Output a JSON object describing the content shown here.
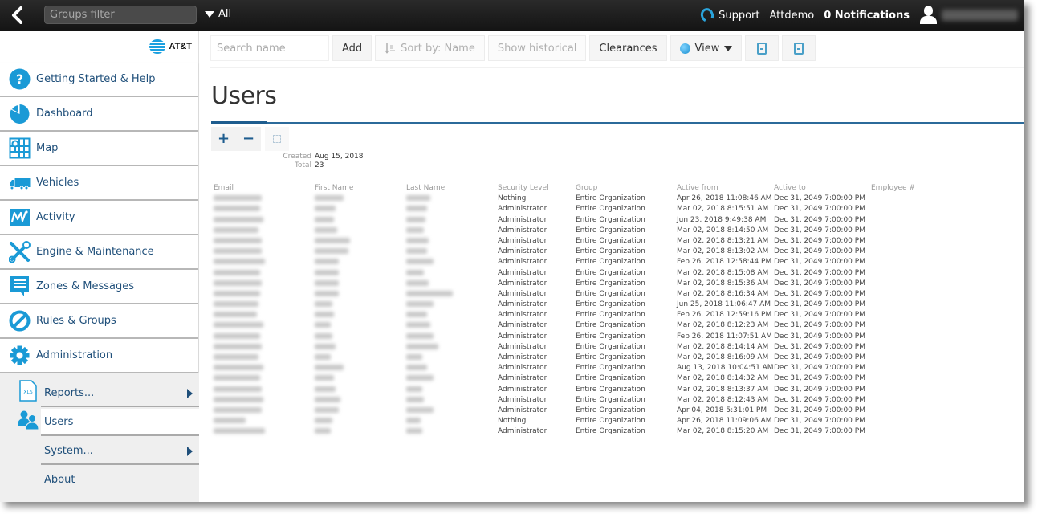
{
  "topbar": {
    "groups_filter_placeholder": "Groups filter",
    "groups_filter_value": "",
    "group_dropdown": "All",
    "support": "Support",
    "account": "Attdemo",
    "notifications": "0 Notifications"
  },
  "brand": {
    "name": "AT&T",
    "color": "#1aa0e0"
  },
  "sidebar": {
    "items": [
      {
        "label": "Getting Started & Help",
        "icon": "help-icon"
      },
      {
        "label": "Dashboard",
        "icon": "dashboard-icon"
      },
      {
        "label": "Map",
        "icon": "map-icon"
      },
      {
        "label": "Vehicles",
        "icon": "truck-icon"
      },
      {
        "label": "Activity",
        "icon": "activity-icon"
      },
      {
        "label": "Engine & Maintenance",
        "icon": "wrench-icon"
      },
      {
        "label": "Zones & Messages",
        "icon": "message-icon"
      },
      {
        "label": "Rules & Groups",
        "icon": "prohibit-icon"
      },
      {
        "label": "Administration",
        "icon": "gear-icon"
      }
    ],
    "submenu": [
      {
        "label": "Reports...",
        "has_arrow": true,
        "icon": "xls-file-icon",
        "icon_text": "XLS"
      },
      {
        "label": "Users",
        "active": true,
        "icon": "users-icon"
      },
      {
        "label": "System...",
        "has_arrow": true
      },
      {
        "label": "About"
      }
    ],
    "accent_color": "#1a9ad6",
    "text_color": "#1f4f7a"
  },
  "toolbar": {
    "search_placeholder": "Search name",
    "search_value": "",
    "add": "Add",
    "sort": "Sort by: Name",
    "show_historical": "Show historical",
    "clearances": "Clearances",
    "view": "View"
  },
  "page": {
    "title": "Users",
    "expand_label": "+",
    "collapse_label": "−",
    "meta": {
      "created_label": "Created",
      "created_value": "Aug 15, 2018",
      "total_label": "Total",
      "total_value": "23"
    }
  },
  "table": {
    "columns": [
      "Email",
      "First Name",
      "Last Name",
      "Security Level",
      "Group",
      "Active from",
      "Active to",
      "Employee #"
    ],
    "rows": [
      {
        "security": "Nothing",
        "group": "Entire Organization",
        "from": "Apr 26, 2018 11:08:46 AM",
        "to": "Dec 31, 2049 7:00:00 PM",
        "employee": ""
      },
      {
        "security": "Administrator",
        "group": "Entire Organization",
        "from": "Mar 02, 2018 8:15:51 AM",
        "to": "Dec 31, 2049 7:00:00 PM",
        "employee": ""
      },
      {
        "security": "Administrator",
        "group": "Entire Organization",
        "from": "Jun 23, 2018 9:49:38 AM",
        "to": "Dec 31, 2049 7:00:00 PM",
        "employee": ""
      },
      {
        "security": "Administrator",
        "group": "Entire Organization",
        "from": "Mar 02, 2018 8:14:50 AM",
        "to": "Dec 31, 2049 7:00:00 PM",
        "employee": ""
      },
      {
        "security": "Administrator",
        "group": "Entire Organization",
        "from": "Mar 02, 2018 8:13:21 AM",
        "to": "Dec 31, 2049 7:00:00 PM",
        "employee": ""
      },
      {
        "security": "Administrator",
        "group": "Entire Organization",
        "from": "Mar 02, 2018 8:13:02 AM",
        "to": "Dec 31, 2049 7:00:00 PM",
        "employee": ""
      },
      {
        "security": "Administrator",
        "group": "Entire Organization",
        "from": "Feb 26, 2018 12:58:44 PM",
        "to": "Dec 31, 2049 7:00:00 PM",
        "employee": ""
      },
      {
        "security": "Administrator",
        "group": "Entire Organization",
        "from": "Mar 02, 2018 8:15:08 AM",
        "to": "Dec 31, 2049 7:00:00 PM",
        "employee": ""
      },
      {
        "security": "Administrator",
        "group": "Entire Organization",
        "from": "Mar 02, 2018 8:15:36 AM",
        "to": "Dec 31, 2049 7:00:00 PM",
        "employee": ""
      },
      {
        "security": "Administrator",
        "group": "Entire Organization",
        "from": "Mar 02, 2018 8:16:34 AM",
        "to": "Dec 31, 2049 7:00:00 PM",
        "employee": ""
      },
      {
        "security": "Administrator",
        "group": "Entire Organization",
        "from": "Jun 25, 2018 11:06:47 AM",
        "to": "Dec 31, 2049 7:00:00 PM",
        "employee": ""
      },
      {
        "security": "Administrator",
        "group": "Entire Organization",
        "from": "Feb 26, 2018 12:59:16 PM",
        "to": "Dec 31, 2049 7:00:00 PM",
        "employee": ""
      },
      {
        "security": "Administrator",
        "group": "Entire Organization",
        "from": "Mar 02, 2018 8:12:23 AM",
        "to": "Dec 31, 2049 7:00:00 PM",
        "employee": ""
      },
      {
        "security": "Administrator",
        "group": "Entire Organization",
        "from": "Feb 26, 2018 11:07:51 AM",
        "to": "Dec 31, 2049 7:00:00 PM",
        "employee": ""
      },
      {
        "security": "Administrator",
        "group": "Entire Organization",
        "from": "Mar 02, 2018 8:14:14 AM",
        "to": "Dec 31, 2049 7:00:00 PM",
        "employee": ""
      },
      {
        "security": "Administrator",
        "group": "Entire Organization",
        "from": "Mar 02, 2018 8:16:09 AM",
        "to": "Dec 31, 2049 7:00:00 PM",
        "employee": ""
      },
      {
        "security": "Administrator",
        "group": "Entire Organization",
        "from": "Aug 13, 2018 10:04:51 AM",
        "to": "Dec 31, 2049 7:00:00 PM",
        "employee": ""
      },
      {
        "security": "Administrator",
        "group": "Entire Organization",
        "from": "Mar 02, 2018 8:14:32 AM",
        "to": "Dec 31, 2049 7:00:00 PM",
        "employee": ""
      },
      {
        "security": "Administrator",
        "group": "Entire Organization",
        "from": "Mar 02, 2018 8:13:37 AM",
        "to": "Dec 31, 2049 7:00:00 PM",
        "employee": ""
      },
      {
        "security": "Administrator",
        "group": "Entire Organization",
        "from": "Mar 02, 2018 8:12:43 AM",
        "to": "Dec 31, 2049 7:00:00 PM",
        "employee": ""
      },
      {
        "security": "Administrator",
        "group": "Entire Organization",
        "from": "Apr 04, 2018 5:31:01 PM",
        "to": "Dec 31, 2049 7:00:00 PM",
        "employee": ""
      },
      {
        "security": "Nothing",
        "group": "Entire Organization",
        "from": "Apr 26, 2018 11:09:06 AM",
        "to": "Dec 31, 2049 7:00:00 PM",
        "employee": ""
      },
      {
        "security": "Administrator",
        "group": "Entire Organization",
        "from": "Mar 02, 2018 8:15:20 AM",
        "to": "Dec 31, 2049 7:00:00 PM",
        "employee": ""
      }
    ],
    "redacted_columns": [
      "Email",
      "First Name",
      "Last Name"
    ]
  },
  "colors": {
    "topbar_bg": "#1a1a1a",
    "accent": "#1a9ad6",
    "title_rule": "#2b6a9a",
    "support_ring": "#2aa4dc"
  }
}
